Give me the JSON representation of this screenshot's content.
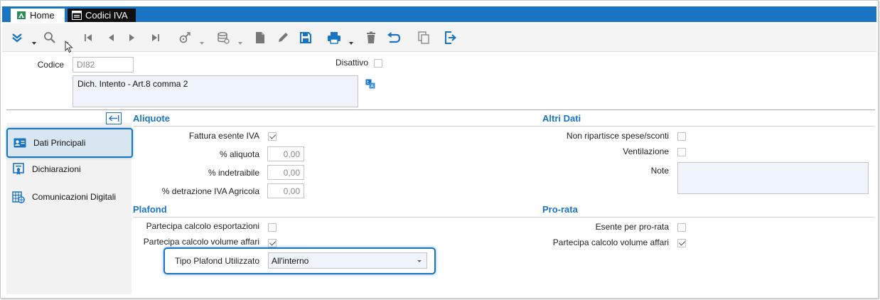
{
  "tabs": [
    {
      "label": "Home",
      "icon": "home-logo-icon"
    },
    {
      "label": "Codici IVA",
      "icon": "form-window-icon"
    }
  ],
  "toolbar": {
    "icons": [
      "expand-menu-icon",
      "search-icon",
      "first-record-icon",
      "previous-record-icon",
      "next-record-icon",
      "last-record-icon",
      "filter-icon",
      "database-icon",
      "new-document-icon",
      "edit-icon",
      "save-icon",
      "print-icon",
      "delete-icon",
      "undo-icon",
      "copy-icon",
      "exit-icon"
    ]
  },
  "header": {
    "codice_label": "Codice",
    "codice_value": "DI82",
    "disattivo_label": "Disattivo",
    "disattivo_checked": false,
    "description": "Dich. Intento - Art.8 comma 2"
  },
  "sidebar": {
    "items": [
      {
        "label": "Dati Principali",
        "active": true
      },
      {
        "label": "Dichiarazioni",
        "active": false
      },
      {
        "label": "Comunicazioni Digitali",
        "active": false
      }
    ]
  },
  "aliquote": {
    "title": "Aliquote",
    "fattura_esente_label": "Fattura esente IVA",
    "fattura_esente_checked": true,
    "aliquota_label": "% aliquota",
    "aliquota_value": "0,00",
    "indetraibile_label": "% indetraibile",
    "indetraibile_value": "0,00",
    "detrazione_label": "% detrazione IVA Agricola",
    "detrazione_value": "0,00"
  },
  "altri_dati": {
    "title": "Altri Dati",
    "non_ripartisce_label": "Non ripartisce spese/sconti",
    "non_ripartisce_checked": false,
    "ventilazione_label": "Ventilazione",
    "ventilazione_checked": false,
    "note_label": "Note",
    "note_value": ""
  },
  "plafond": {
    "title": "Plafond",
    "esportazioni_label": "Partecipa calcolo esportazioni",
    "esportazioni_checked": false,
    "volume_label": "Partecipa calcolo volume affari",
    "volume_checked": true,
    "tipo_label": "Tipo Plafond Utilizzato",
    "tipo_value": "All'interno"
  },
  "prorata": {
    "title": "Pro-rata",
    "esente_label": "Esente per pro-rata",
    "esente_checked": false,
    "volume_label": "Partecipa calcolo volume affari",
    "volume_checked": true
  },
  "colors": {
    "accent": "#1a74c4",
    "tab_dark": "#101010",
    "field_bg": "#eef4fa",
    "sidebar_bg": "#f2f2f2"
  }
}
